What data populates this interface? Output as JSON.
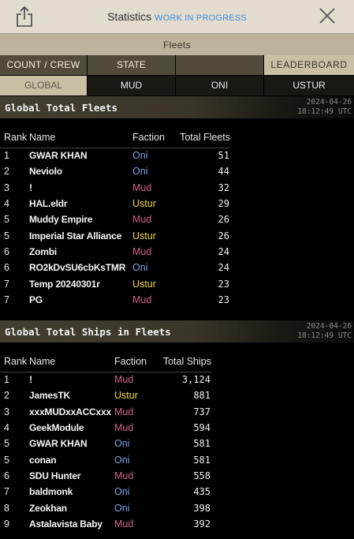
{
  "header": {
    "title": "Statistics",
    "status": "WORK IN PROGRESS",
    "subtitle": "Fleets"
  },
  "tabs_primary": [
    "COUNT / CREW",
    "STATE",
    "",
    "LEADERBOARD"
  ],
  "tabs_secondary": [
    "GLOBAL",
    "MUD",
    "ONI",
    "USTUR"
  ],
  "colors": {
    "oni": "#7e9ee6",
    "mud": "#d25f8f",
    "ustur": "#ecd93a",
    "accent_link": "#3f8fe0"
  },
  "fleets_section": {
    "title": "Global Total Fleets",
    "date": "2024-04-26",
    "time": "18:12:49 UTC",
    "columns": [
      "Rank",
      "Name",
      "Faction",
      "Total Fleets"
    ],
    "rows": [
      {
        "rank": "1",
        "name": "GWAR KHAN",
        "faction": "Oni",
        "value": "51"
      },
      {
        "rank": "2",
        "name": "Neviolo",
        "faction": "Oni",
        "value": "44"
      },
      {
        "rank": "3",
        "name": "!",
        "faction": "Mud",
        "value": "32"
      },
      {
        "rank": "4",
        "name": "HAL.eldr",
        "faction": "Ustur",
        "value": "29"
      },
      {
        "rank": "5",
        "name": "Muddy Empire",
        "faction": "Mud",
        "value": "26"
      },
      {
        "rank": "5",
        "name": "Imperial Star Alliance",
        "faction": "Ustur",
        "value": "26"
      },
      {
        "rank": "6",
        "name": "Zombi",
        "faction": "Mud",
        "value": "24"
      },
      {
        "rank": "6",
        "name": "RO2kDvSU6cbKsTMR",
        "faction": "Oni",
        "value": "24"
      },
      {
        "rank": "7",
        "name": "Temp 20240301r",
        "faction": "Ustur",
        "value": "23"
      },
      {
        "rank": "7",
        "name": "PG",
        "faction": "Mud",
        "value": "23"
      }
    ]
  },
  "ships_section": {
    "title": "Global Total Ships in Fleets",
    "date": "2024-04-26",
    "time": "18:12:49 UTC",
    "columns": [
      "Rank",
      "Name",
      "Faction",
      "Total Ships"
    ],
    "rows": [
      {
        "rank": "1",
        "name": "!",
        "faction": "Mud",
        "value": "3,124"
      },
      {
        "rank": "2",
        "name": "JamesTK",
        "faction": "Ustur",
        "value": "881"
      },
      {
        "rank": "3",
        "name": "xxxMUDxxACCxxx",
        "faction": "Mud",
        "value": "737"
      },
      {
        "rank": "4",
        "name": "GeekModule",
        "faction": "Mud",
        "value": "594"
      },
      {
        "rank": "5",
        "name": "GWAR KHAN",
        "faction": "Oni",
        "value": "581"
      },
      {
        "rank": "5",
        "name": "conan",
        "faction": "Oni",
        "value": "581"
      },
      {
        "rank": "6",
        "name": "SDU Hunter",
        "faction": "Mud",
        "value": "558"
      },
      {
        "rank": "7",
        "name": "baldmonk",
        "faction": "Oni",
        "value": "435"
      },
      {
        "rank": "8",
        "name": "Zeokhan",
        "faction": "Oni",
        "value": "398"
      },
      {
        "rank": "9",
        "name": "Astalavista Baby",
        "faction": "Mud",
        "value": "392"
      }
    ]
  }
}
